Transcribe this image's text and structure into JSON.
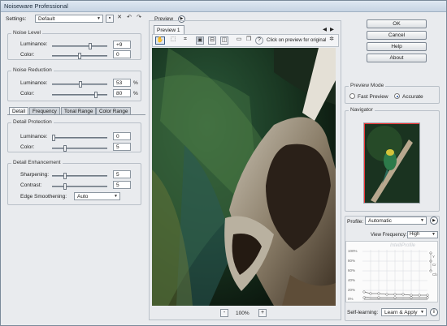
{
  "window": {
    "title": "Noiseware Professional"
  },
  "settings": {
    "label": "Settings:",
    "value": "Default"
  },
  "noise_level": {
    "title": "Noise Level",
    "luminance": {
      "label": "Luminance:",
      "value": "+9"
    },
    "color": {
      "label": "Color:",
      "value": "0"
    }
  },
  "noise_reduction": {
    "title": "Noise Reduction",
    "luminance": {
      "label": "Luminance:",
      "value": "53",
      "unit": "%"
    },
    "color": {
      "label": "Color:",
      "value": "80",
      "unit": "%"
    }
  },
  "tabs": [
    "Detail",
    "Frequency",
    "Tonal Range",
    "Color Range"
  ],
  "detail_protection": {
    "title": "Detail Protection",
    "luminance": {
      "label": "Luminance:",
      "value": "0"
    },
    "color": {
      "label": "Color:",
      "value": "5"
    }
  },
  "detail_enhancement": {
    "title": "Detail Enhancement",
    "sharpening": {
      "label": "Sharpening:",
      "value": "5"
    },
    "contrast": {
      "label": "Contrast:",
      "value": "5"
    },
    "edge": {
      "label": "Edge Smoothening:",
      "value": "Auto"
    }
  },
  "preview": {
    "title": "Preview",
    "tab": "Preview 1",
    "hint": "Click on preview for original",
    "zoom": "100%",
    "zoom_minus": "-",
    "zoom_plus": "+"
  },
  "buttons": {
    "ok": "OK",
    "cancel": "Cancel",
    "help": "Help",
    "about": "About"
  },
  "preview_mode": {
    "title": "Preview Mode",
    "fast": "Fast Preview",
    "accurate": "Accurate",
    "selected": "accurate"
  },
  "navigator": {
    "title": "Navigator"
  },
  "profile": {
    "label": "Profile:",
    "value": "Automatic",
    "view_freq_label": "View Frequency:",
    "view_freq_value": "High",
    "watermark": "IntelliProfile",
    "y_ticks": [
      "100%",
      "80%",
      "60%",
      "40%",
      "20%",
      "0%"
    ],
    "row_labels": [
      "Y",
      "Cr",
      "Cb"
    ],
    "self_learning_label": "Self-learning:",
    "self_learning_value": "Learn & Apply"
  },
  "colors": {
    "accent": "#1f4fa0"
  }
}
